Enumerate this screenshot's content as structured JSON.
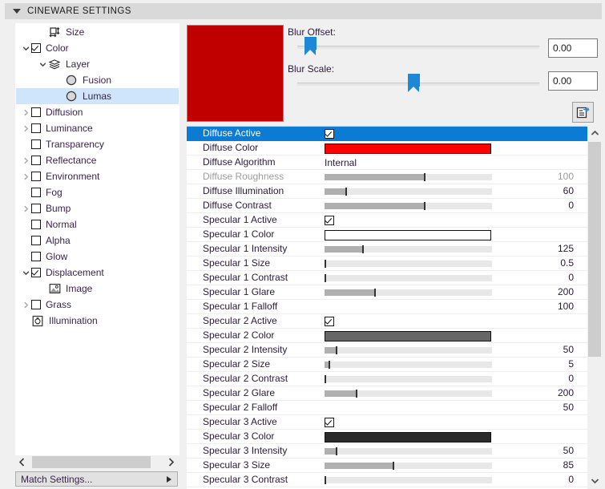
{
  "window": {
    "title": "CINEWARE SETTINGS",
    "collapse_icon": "triangle-down-icon"
  },
  "tree": {
    "items": [
      {
        "label": "Size",
        "indent": 1,
        "arrow": "none",
        "control": "icon",
        "icon": "size-icon",
        "checked": false,
        "selected": false
      },
      {
        "label": "Color",
        "indent": 0,
        "arrow": "down",
        "control": "checkbox",
        "icon": "",
        "checked": true,
        "selected": false
      },
      {
        "label": "Layer",
        "indent": 1,
        "arrow": "down",
        "control": "icon",
        "icon": "layers-icon",
        "checked": false,
        "selected": false
      },
      {
        "label": "Fusion",
        "indent": 2,
        "arrow": "none",
        "control": "icon",
        "icon": "sphere-icon",
        "checked": false,
        "selected": false
      },
      {
        "label": "Lumas",
        "indent": 2,
        "arrow": "none",
        "control": "icon",
        "icon": "sphere-icon",
        "checked": false,
        "selected": true
      },
      {
        "label": "Diffusion",
        "indent": 0,
        "arrow": "right",
        "control": "checkbox",
        "icon": "",
        "checked": false,
        "selected": false
      },
      {
        "label": "Luminance",
        "indent": 0,
        "arrow": "right",
        "control": "checkbox",
        "icon": "",
        "checked": false,
        "selected": false
      },
      {
        "label": "Transparency",
        "indent": 0,
        "arrow": "none",
        "control": "checkbox",
        "icon": "",
        "checked": false,
        "selected": false
      },
      {
        "label": "Reflectance",
        "indent": 0,
        "arrow": "right",
        "control": "checkbox",
        "icon": "",
        "checked": false,
        "selected": false
      },
      {
        "label": "Environment",
        "indent": 0,
        "arrow": "right",
        "control": "checkbox",
        "icon": "",
        "checked": false,
        "selected": false
      },
      {
        "label": "Fog",
        "indent": 0,
        "arrow": "none",
        "control": "checkbox",
        "icon": "",
        "checked": false,
        "selected": false
      },
      {
        "label": "Bump",
        "indent": 0,
        "arrow": "right",
        "control": "checkbox",
        "icon": "",
        "checked": false,
        "selected": false
      },
      {
        "label": "Normal",
        "indent": 0,
        "arrow": "none",
        "control": "checkbox",
        "icon": "",
        "checked": false,
        "selected": false
      },
      {
        "label": "Alpha",
        "indent": 0,
        "arrow": "none",
        "control": "checkbox",
        "icon": "",
        "checked": false,
        "selected": false
      },
      {
        "label": "Glow",
        "indent": 0,
        "arrow": "none",
        "control": "checkbox",
        "icon": "",
        "checked": false,
        "selected": false
      },
      {
        "label": "Displacement",
        "indent": 0,
        "arrow": "down",
        "control": "checkbox",
        "icon": "",
        "checked": true,
        "selected": false
      },
      {
        "label": "Image",
        "indent": 1,
        "arrow": "none",
        "control": "icon",
        "icon": "image-icon",
        "checked": false,
        "selected": false
      },
      {
        "label": "Grass",
        "indent": 0,
        "arrow": "right",
        "control": "checkbox",
        "icon": "",
        "checked": false,
        "selected": false
      },
      {
        "label": "Illumination",
        "indent": 0,
        "arrow": "none",
        "control": "icon",
        "icon": "illumination-icon",
        "checked": false,
        "selected": false
      }
    ]
  },
  "left_footer": {
    "scroll_left_icon": "chevron-left-icon",
    "scroll_right_icon": "chevron-right-icon",
    "match_settings_label": "Match Settings...",
    "match_settings_arrow": "triangle-right-icon"
  },
  "preview": {
    "color": "#c00000",
    "name": "material-preview-swatch"
  },
  "blur": {
    "offset_label": "Blur Offset:",
    "offset_value": "0.00",
    "offset_knob_pct": 3,
    "scale_label": "Blur Scale:",
    "scale_value": "0.00",
    "scale_knob_pct": 48
  },
  "toolbar": {
    "copy_icon": "copy-to-document-icon"
  },
  "properties": {
    "rows": [
      {
        "name": "Diffuse Active",
        "type": "check",
        "checked": true,
        "value": "",
        "selected": true,
        "dim": false
      },
      {
        "name": "Diffuse Color",
        "type": "color",
        "color": "#ff0000",
        "value": "",
        "selected": false,
        "dim": false
      },
      {
        "name": "Diffuse Algorithm",
        "type": "text",
        "text": "Internal",
        "value": "",
        "selected": false,
        "dim": false
      },
      {
        "name": "Diffuse Roughness",
        "type": "slider",
        "fill": 60,
        "tick": 60,
        "value": "100",
        "selected": false,
        "dim": true
      },
      {
        "name": "Diffuse Illumination",
        "type": "slider",
        "fill": 13,
        "tick": 13,
        "value": "60",
        "selected": false,
        "dim": false
      },
      {
        "name": "Diffuse Contrast",
        "type": "slider",
        "fill": 60,
        "tick": 60,
        "value": "0",
        "selected": false,
        "dim": false
      },
      {
        "name": "Specular 1 Active",
        "type": "check",
        "checked": true,
        "value": "",
        "selected": false,
        "dim": false
      },
      {
        "name": "Specular 1 Color",
        "type": "color",
        "color": "#ffffff",
        "value": "",
        "selected": false,
        "dim": false
      },
      {
        "name": "Specular 1 Intensity",
        "type": "slider",
        "fill": 23,
        "tick": 23,
        "value": "125",
        "selected": false,
        "dim": false
      },
      {
        "name": "Specular 1 Size",
        "type": "slider",
        "fill": 0,
        "tick": 0,
        "value": "0.5",
        "selected": false,
        "dim": false
      },
      {
        "name": "Specular 1 Contrast",
        "type": "slider",
        "fill": 0,
        "tick": 0,
        "value": "0",
        "selected": false,
        "dim": false
      },
      {
        "name": "Specular 1 Glare",
        "type": "slider",
        "fill": 30,
        "tick": 30,
        "value": "200",
        "selected": false,
        "dim": false
      },
      {
        "name": "Specular 1 Falloff",
        "type": "none",
        "value": "100",
        "selected": false,
        "dim": false
      },
      {
        "name": "Specular 2 Active",
        "type": "check",
        "checked": true,
        "value": "",
        "selected": false,
        "dim": false
      },
      {
        "name": "Specular 2 Color",
        "type": "color",
        "color": "#666666",
        "value": "",
        "selected": false,
        "dim": false
      },
      {
        "name": "Specular 2 Intensity",
        "type": "slider",
        "fill": 7,
        "tick": 7,
        "value": "50",
        "selected": false,
        "dim": false
      },
      {
        "name": "Specular 2 Size",
        "type": "slider",
        "fill": 3,
        "tick": 3,
        "value": "5",
        "selected": false,
        "dim": false
      },
      {
        "name": "Specular 2 Contrast",
        "type": "slider",
        "fill": 0,
        "tick": 0,
        "value": "0",
        "selected": false,
        "dim": false
      },
      {
        "name": "Specular 2 Glare",
        "type": "slider",
        "fill": 19,
        "tick": 19,
        "value": "200",
        "selected": false,
        "dim": false
      },
      {
        "name": "Specular 2 Falloff",
        "type": "none",
        "value": "50",
        "selected": false,
        "dim": false
      },
      {
        "name": "Specular 3 Active",
        "type": "check",
        "checked": true,
        "value": "",
        "selected": false,
        "dim": false
      },
      {
        "name": "Specular 3 Color",
        "type": "color",
        "color": "#2b2b2b",
        "value": "",
        "selected": false,
        "dim": false
      },
      {
        "name": "Specular 3 Intensity",
        "type": "slider",
        "fill": 7,
        "tick": 7,
        "value": "50",
        "selected": false,
        "dim": false
      },
      {
        "name": "Specular 3 Size",
        "type": "slider",
        "fill": 41,
        "tick": 41,
        "value": "85",
        "selected": false,
        "dim": false
      },
      {
        "name": "Specular 3 Contrast",
        "type": "slider",
        "fill": 0,
        "tick": 0,
        "value": "0",
        "selected": false,
        "dim": false
      }
    ]
  },
  "scrollbar": {
    "up_icon": "chevron-up-icon",
    "down_icon": "chevron-down-icon"
  }
}
